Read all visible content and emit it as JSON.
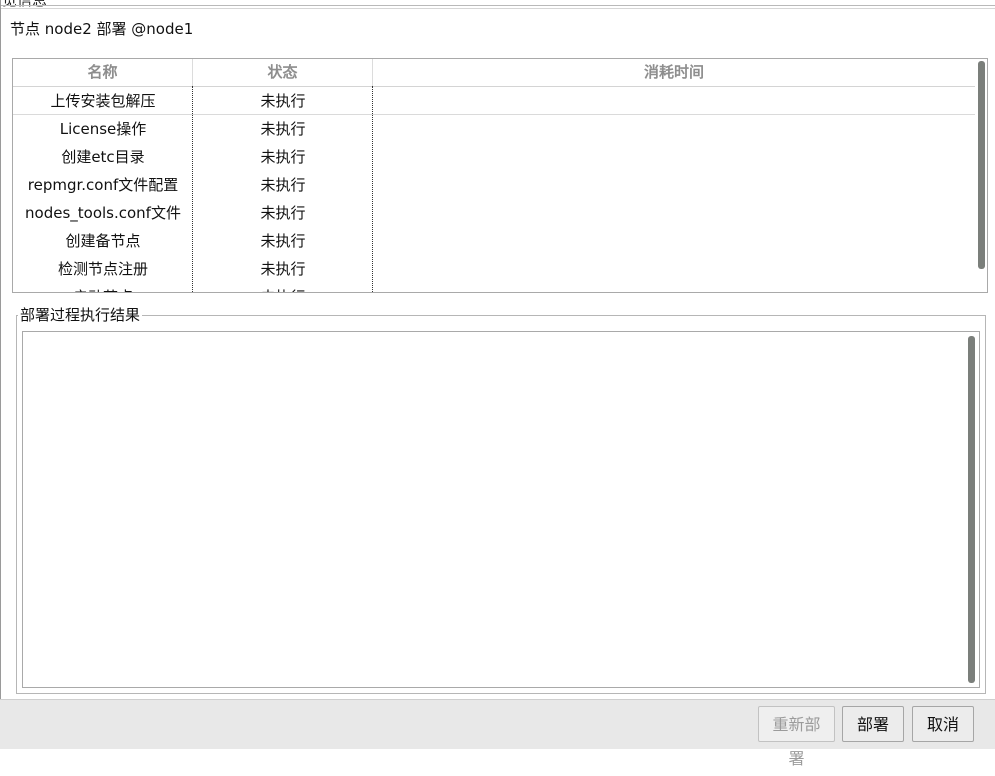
{
  "window": {
    "title_fragment": "览信息"
  },
  "node_title": "节点 node2 部署 @node1",
  "table": {
    "headers": [
      "名称",
      "状态",
      "消耗时间"
    ],
    "rows": [
      {
        "name": "上传安装包解压",
        "status": "未执行",
        "time": ""
      },
      {
        "name": "License操作",
        "status": "未执行",
        "time": ""
      },
      {
        "name": "创建etc目录",
        "status": "未执行",
        "time": ""
      },
      {
        "name": "repmgr.conf文件配置",
        "status": "未执行",
        "time": ""
      },
      {
        "name": "nodes_tools.conf文件",
        "status": "未执行",
        "time": ""
      },
      {
        "name": "创建备节点",
        "status": "未执行",
        "time": ""
      },
      {
        "name": "检测节点注册",
        "status": "未执行",
        "time": ""
      },
      {
        "name": "启动节点",
        "status": "未执行",
        "time": ""
      }
    ]
  },
  "result_group": {
    "title": "部署过程执行结果",
    "content": ""
  },
  "buttons": {
    "redeploy": "重新部署",
    "deploy": "部署",
    "cancel": "取消"
  }
}
